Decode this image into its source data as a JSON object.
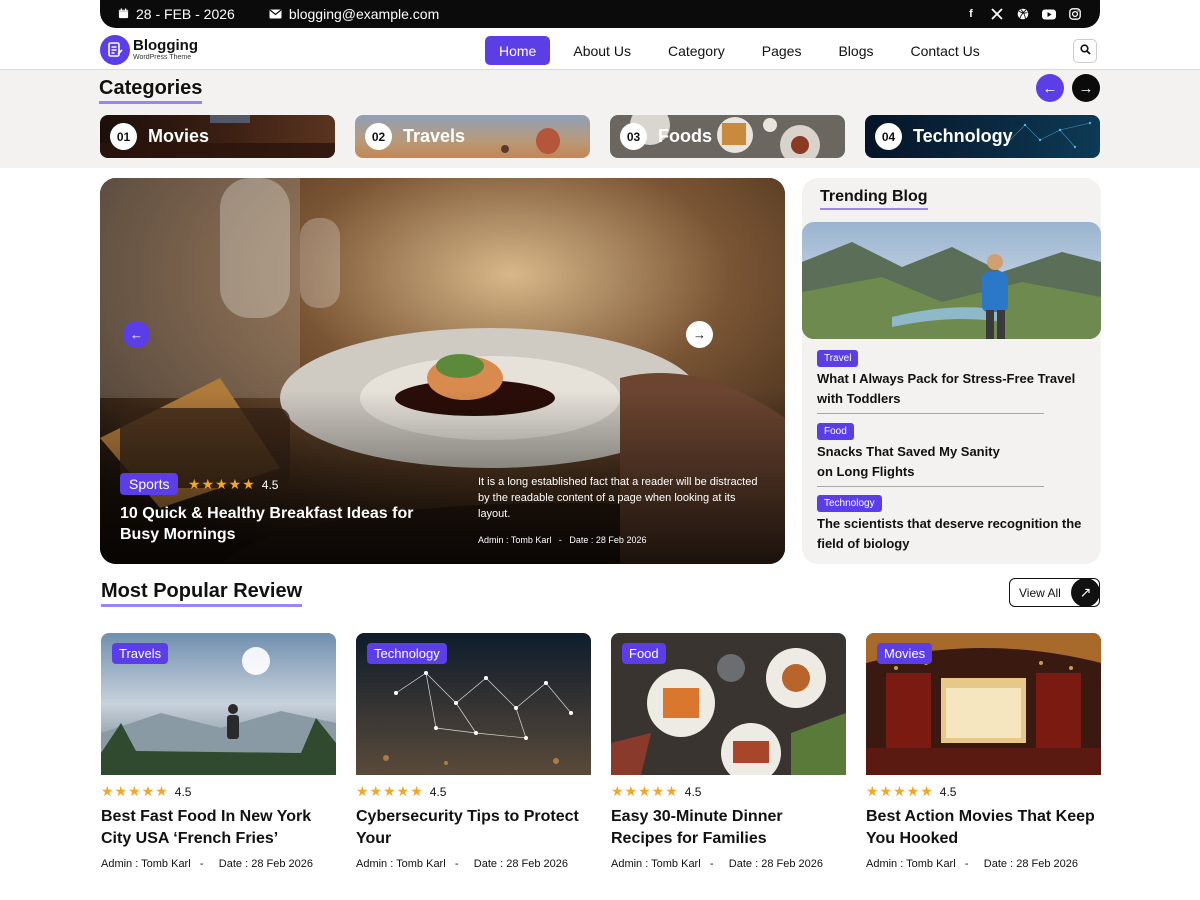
{
  "topbar": {
    "date": "28 - FEB - 2026",
    "email": "blogging@example.com",
    "social_icons": [
      "facebook-icon",
      "x-icon",
      "dribbble-icon",
      "youtube-icon",
      "instagram-icon"
    ]
  },
  "brand": {
    "name": "Blogging",
    "tagline": "WordPress Theme"
  },
  "nav": {
    "items": [
      "Home",
      "About Us",
      "Category",
      "Pages",
      "Blogs",
      "Contact Us"
    ],
    "active": "Home"
  },
  "colors": {
    "accent": "#5b3ee6",
    "underline": "#9a86f3",
    "dark": "#0b0b0b",
    "band": "#f3f2f0",
    "star": "#f5a623"
  },
  "categories": {
    "title": "Categories",
    "items": [
      {
        "num": "01",
        "name": "Movies"
      },
      {
        "num": "02",
        "name": "Travels"
      },
      {
        "num": "03",
        "name": "Foods"
      },
      {
        "num": "04",
        "name": "Technology"
      }
    ]
  },
  "hero": {
    "tag": "Sports",
    "rating": "4.5",
    "title": "10 Quick & Healthy Breakfast Ideas for Busy Mornings",
    "description": "It is a long established fact that a reader will be distracted by the readable content of a page when looking at its layout.",
    "author": "Admin : Tomb Karl",
    "sep": "-",
    "date": "Date : 28  Feb 2026"
  },
  "trending": {
    "title": "Trending Blog",
    "items": [
      {
        "tag": "Travel",
        "title": "What I Always Pack for Stress-Free Travel with Toddlers"
      },
      {
        "tag": "Food",
        "title": "Snacks That Saved My Sanity on Long Flights"
      },
      {
        "tag": "Technology",
        "title": "The scientists that deserve recognition the field of biology"
      }
    ]
  },
  "popular": {
    "title": "Most Popular Review",
    "view_all": "View All",
    "cards": [
      {
        "tag": "Travels",
        "rating": "4.5",
        "title": "Best Fast Food In New York City USA ‘French Fries’",
        "author": "Admin : Tomb Karl",
        "sep": "-",
        "date": "Date : 28  Feb 2026"
      },
      {
        "tag": "Technology",
        "rating": "4.5",
        "title": "Cybersecurity Tips to Protect Your",
        "author": "Admin : Tomb Karl",
        "sep": "-",
        "date": "Date : 28  Feb 2026"
      },
      {
        "tag": "Food",
        "rating": "4.5",
        "title": "Easy 30-Minute Dinner Recipes for Families",
        "author": "Admin : Tomb Karl",
        "sep": "-",
        "date": "Date : 28  Feb 2026"
      },
      {
        "tag": "Movies",
        "rating": "4.5",
        "title": "Best Action Movies That Keep You Hooked",
        "author": "Admin : Tomb Karl",
        "sep": "-",
        "date": "Date : 28  Feb 2026"
      }
    ]
  }
}
